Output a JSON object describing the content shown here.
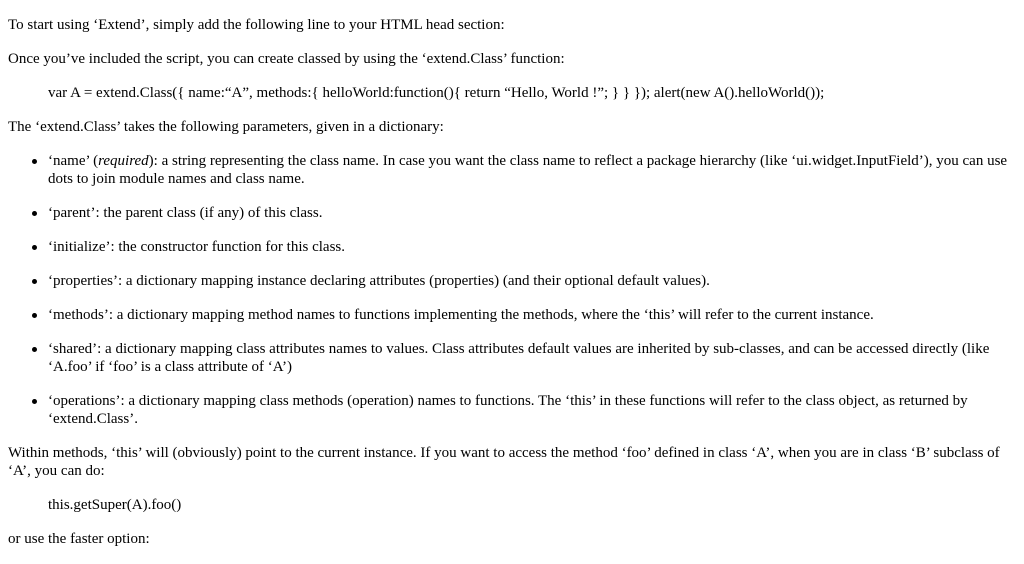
{
  "intro": {
    "line1": "To start using ‘Extend’, simply add the following line to your HTML head section:",
    "line2": "Once you’ve included the script, you can create classed by using the ‘extend.Class’ function:"
  },
  "code_example": "var A = extend.Class({ name:“A”, methods:{ helloWorld:function(){ return “Hello, World !”; } } }); alert(new A().helloWorld());",
  "params_intro": "The ‘extend.Class’ takes the following parameters, given in a dictionary:",
  "params": [
    {
      "name_before": "‘name’ (",
      "name_emphasis": "required",
      "name_after": "): a string representing the class name. In case you want the class name to reflect a package hierarchy (like ‘ui.widget.InputField’), you can use dots to join module names and class name."
    },
    {
      "text": "‘parent’: the parent class (if any) of this class."
    },
    {
      "text": "‘initialize’: the constructor function for this class."
    },
    {
      "text": "‘properties’: a dictionary mapping instance declaring attributes (properties) (and their optional default values)."
    },
    {
      "text": "‘methods’: a dictionary mapping method names to functions implementing the methods, where the ‘this’ will refer to the current instance."
    },
    {
      "text": "‘shared’: a dictionary mapping class attributes names to values. Class attributes default values are inherited by sub-classes, and can be accessed directly (like ‘A.foo’ if ‘foo’ is a class attribute of ‘A’)"
    },
    {
      "text": "‘operations’: a dictionary mapping class methods (operation) names to functions. The ‘this’ in these functions will refer to the class object, as returned by ‘extend.Class’."
    }
  ],
  "within_methods": "Within methods, ‘this’ will (obviously) point to the current instance. If you want to access the method ‘foo’ defined in class ‘A’, when you are in class ‘B’ subclass of ‘A’, you can do:",
  "super_call": "this.getSuper(A).foo()",
  "faster_option": "or use the faster option:"
}
